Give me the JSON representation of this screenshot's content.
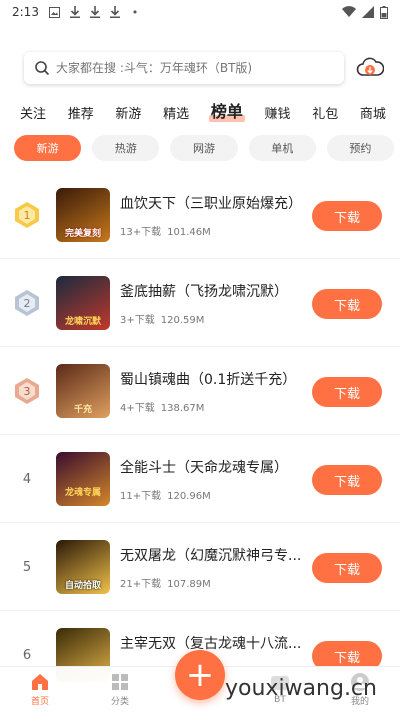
{
  "status": {
    "time": "2:13",
    "icons": [
      "image-icon",
      "download-icon",
      "download-icon",
      "download-icon",
      "dot-icon"
    ],
    "right_icons": [
      "wifi-icon",
      "signal-icon",
      "battery-icon"
    ]
  },
  "search": {
    "placeholder": "大家都在搜 :斗气：万年魂环（BT版)"
  },
  "nav": {
    "tabs": [
      "关注",
      "推荐",
      "新游",
      "精选",
      "榜单",
      "赚钱",
      "礼包",
      "商城"
    ],
    "active": "榜单"
  },
  "subtabs": {
    "items": [
      "新游",
      "热游",
      "网游",
      "单机",
      "预约"
    ],
    "active": "新游"
  },
  "games": [
    {
      "rank": "1",
      "title": "血饮天下（三职业原始爆充）",
      "downloads": "13+下载",
      "size": "101.46M",
      "button": "下载",
      "cover_text": "完美复刻",
      "cover_colors": [
        "#3a1a0a",
        "#c77a1c"
      ]
    },
    {
      "rank": "2",
      "title": "釜底抽薪（飞扬龙啸沉默）",
      "downloads": "3+下载",
      "size": "120.59M",
      "button": "下载",
      "cover_text": "龙啸沉默",
      "cover_colors": [
        "#1b2a3e",
        "#c0392b"
      ]
    },
    {
      "rank": "3",
      "title": "蜀山镇魂曲（0.1折送千充）",
      "downloads": "4+下载",
      "size": "138.67M",
      "button": "下载",
      "cover_text": "千充",
      "cover_colors": [
        "#5a2a18",
        "#e0a060"
      ]
    },
    {
      "rank": "4",
      "title": "全能斗士（天命龙魂专属）",
      "downloads": "11+下载",
      "size": "120.96M",
      "button": "下载",
      "cover_text": "龙魂专属",
      "cover_colors": [
        "#3a0d2e",
        "#d4872a"
      ]
    },
    {
      "rank": "5",
      "title": "无双屠龙（幻魔沉默神弓专...",
      "downloads": "21+下载",
      "size": "107.89M",
      "button": "下载",
      "cover_text": "自动拾取",
      "cover_colors": [
        "#2a1808",
        "#f2c24a"
      ]
    },
    {
      "rank": "6",
      "title": "主宰无双（复古龙魂十八流...",
      "downloads": "",
      "size": "",
      "button": "下载",
      "cover_text": "",
      "cover_colors": [
        "#3a2a08",
        "#e2b34a"
      ]
    }
  ],
  "bottom": {
    "items": [
      {
        "label": "首页",
        "icon": "home-icon",
        "active": true
      },
      {
        "label": "分类",
        "icon": "grid-icon",
        "active": false
      },
      {
        "label": "",
        "icon": "",
        "active": false
      },
      {
        "label": "BT",
        "icon": "bt-icon",
        "active": false
      },
      {
        "label": "我的",
        "icon": "profile-icon",
        "active": false
      }
    ],
    "fab": "+"
  },
  "watermark": "youxiwang.cn",
  "colors": {
    "accent": "#ff7043",
    "chip_bg": "#f3f3f3"
  }
}
